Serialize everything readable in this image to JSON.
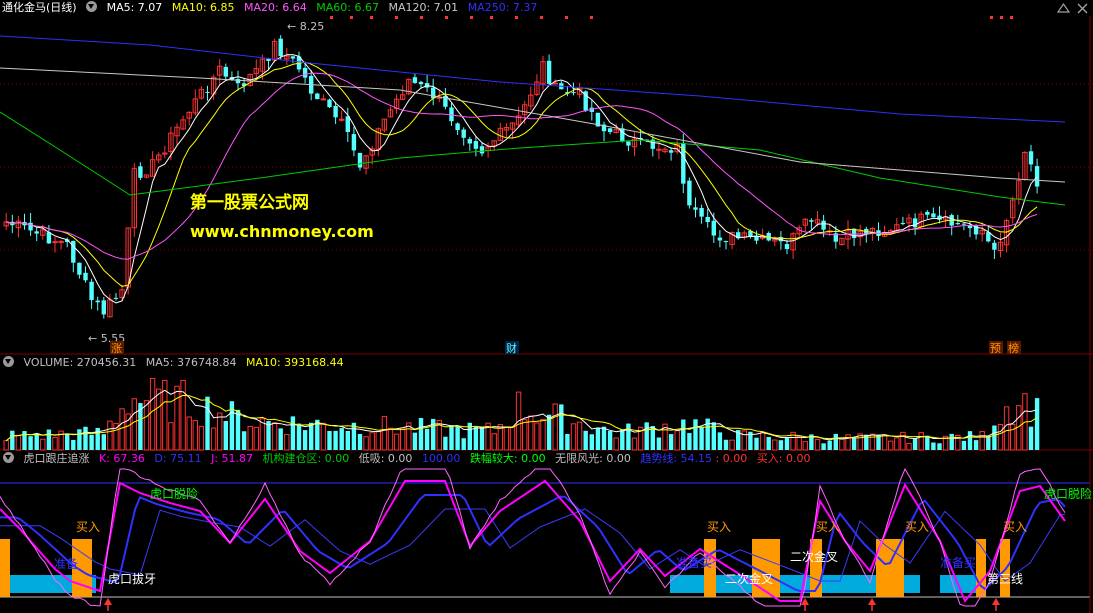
{
  "colors": {
    "up": "#ff3232",
    "down": "#54ffff",
    "grid": "#800000",
    "ma5": "#ffffff",
    "ma10": "#ffff00",
    "ma20": "#ff55ff",
    "ma60": "#00cc00",
    "ma120": "#c8c8c8",
    "ma250": "#2f2fff",
    "orange": "#ff9900",
    "cyan_bar": "#00aadd",
    "magenta": "#ff00ff",
    "blue": "#3030ff"
  },
  "main": {
    "title": "通化金马(日线)",
    "indicators": [
      {
        "label": "MA5: 7.07",
        "color": "#ffffff"
      },
      {
        "label": "MA10: 6.85",
        "color": "#ffff00"
      },
      {
        "label": "MA20: 6.64",
        "color": "#ff55ff"
      },
      {
        "label": "MA60: 6.67",
        "color": "#00cc00"
      },
      {
        "label": "MA120: 7.01",
        "color": "#c8c8c8"
      },
      {
        "label": "MA250: 7.37",
        "color": "#2f2fff"
      }
    ],
    "high_label": "8.25",
    "low_label": "5.55",
    "watermark_title": "第一股票公式网",
    "watermark_url": "www.chnmoney.com",
    "event_markers": [
      "涨",
      "财",
      "预",
      "榜"
    ]
  },
  "volume": {
    "indicators": [
      {
        "label": "VOLUME: 270456.31",
        "color": "#c0c0c0"
      },
      {
        "label": "MA5: 376748.84",
        "color": "#c0c0c0"
      },
      {
        "label": "MA10: 393168.44",
        "color": "#ffff00"
      }
    ]
  },
  "indicator": {
    "name": "虎口跟庄追涨",
    "values": [
      {
        "label": "K: 67.36",
        "color": "#ff00ff"
      },
      {
        "label": "D: 75.11",
        "color": "#3030ff"
      },
      {
        "label": "J: 51.87",
        "color": "#ff00ff"
      },
      {
        "label": "机构建仓区: 0.00",
        "color": "#00cc00"
      },
      {
        "label": "低吸: 0.00",
        "color": "#c0c0c0"
      },
      {
        "label": "100.00",
        "color": "#3030ff"
      },
      {
        "label": "跌幅较大: 0.00",
        "color": "#00ff00"
      },
      {
        "label": "无限风光: 0.00",
        "color": "#c0c0c0"
      },
      {
        "label": "趋势线: 54.15",
        "color": "#3030ff"
      },
      {
        "label": ": 0.00",
        "color": "#ff3232"
      },
      {
        "label": "买入: 0.00",
        "color": "#ff3232"
      }
    ],
    "annotations": [
      {
        "text": "虎口脱险",
        "color": "#00ff00"
      },
      {
        "text": "虎口脱险",
        "color": "#00ff00"
      },
      {
        "text": "买入",
        "color": "#ff9900"
      },
      {
        "text": "买入",
        "color": "#ff9900"
      },
      {
        "text": "买入",
        "color": "#ff9900"
      },
      {
        "text": "买入",
        "color": "#ff9900"
      },
      {
        "text": "买入",
        "color": "#ff9900"
      },
      {
        "text": "准备",
        "color": "#3030ff"
      },
      {
        "text": "准备买",
        "color": "#3030ff"
      },
      {
        "text": "准备买",
        "color": "#3030ff"
      },
      {
        "text": "虎口拔牙",
        "color": "#ffffff"
      },
      {
        "text": "二次金叉",
        "color": "#ffffff"
      },
      {
        "text": "二次金叉",
        "color": "#ffffff"
      },
      {
        "text": "第三线",
        "color": "#ffffff"
      }
    ]
  }
}
